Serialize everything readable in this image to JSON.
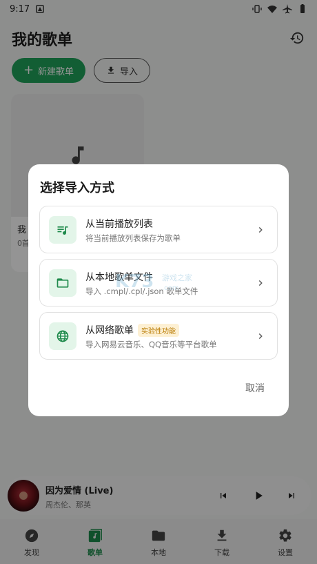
{
  "status_bar": {
    "time": "9:17"
  },
  "header": {
    "title": "我的歌单"
  },
  "actions": {
    "new_label": "新建歌单",
    "import_label": "导入"
  },
  "playlist": {
    "name": "我",
    "count": "0首"
  },
  "dialog": {
    "title": "选择导入方式",
    "options": [
      {
        "title": "从当前播放列表",
        "desc": "将当前播放列表保存为歌单",
        "icon": "queue-music-icon"
      },
      {
        "title": "从本地歌单文件",
        "desc": "导入 .cmpl/.cpl/.json 歌单文件",
        "icon": "folder-icon"
      },
      {
        "title": "从网络歌单",
        "badge": "实验性功能",
        "desc": "导入网易云音乐、QQ音乐等平台歌单",
        "icon": "globe-icon"
      }
    ],
    "cancel_label": "取消"
  },
  "player": {
    "title": "因为爱情 (Live)",
    "artist": "周杰伦、那英"
  },
  "nav": [
    {
      "label": "发现",
      "icon": "compass-icon"
    },
    {
      "label": "歌单",
      "icon": "playlist-icon",
      "active": true
    },
    {
      "label": "本地",
      "icon": "folder-icon"
    },
    {
      "label": "下载",
      "icon": "download-icon"
    },
    {
      "label": "设置",
      "icon": "gear-icon"
    }
  ],
  "colors": {
    "accent": "#1fa35a",
    "badge_bg": "#fdf0d3",
    "badge_text": "#b87900"
  }
}
